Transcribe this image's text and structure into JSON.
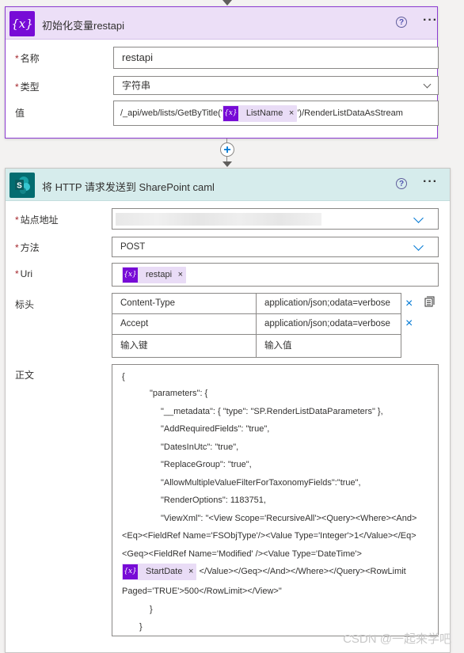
{
  "card1": {
    "title": "初始化变量restapi",
    "fields": {
      "name_label": "名称",
      "name_value": "restapi",
      "type_label": "类型",
      "type_value": "字符串",
      "value_label": "值",
      "value_prefix": "/_api/web/lists/GetByTitle('",
      "value_token": "ListName",
      "value_suffix": "')/RenderListDataAsStream"
    }
  },
  "card2": {
    "title": "将 HTTP 请求发送到 SharePoint caml",
    "site_label": "站点地址",
    "method_label": "方法",
    "method_value": "POST",
    "uri_label": "Uri",
    "uri_token": "restapi",
    "headers_label": "标头",
    "headers": [
      {
        "key": "Content-Type",
        "value": "application/json;odata=verbose"
      },
      {
        "key": "Accept",
        "value": "application/json;odata=verbose"
      }
    ],
    "header_key_placeholder": "输入键",
    "header_value_placeholder": "输入值",
    "body_label": "正文",
    "body_lines": [
      "{",
      "\"parameters\": {",
      "\"__metadata\": { \"type\": \"SP.RenderListDataParameters\" },",
      "\"AddRequiredFields\": \"true\",",
      "\"DatesInUtc\": \"true\",",
      "\"ReplaceGroup\": \"true\",",
      "\"AllowMultipleValueFilterForTaxonomyFields\":\"true\",",
      "\"RenderOptions\": 1183751,",
      "\"ViewXml\": \"<View Scope='RecursiveAll'><Query><Where><And>",
      "<Eq><FieldRef Name='FSObjType'/><Value Type='Integer'>1</Value></Eq>",
      "<Geq><FieldRef Name='Modified' /><Value Type='DateTime'>",
      "</Value></Geq></And></Where></Query><RowLimit",
      "Paged='TRUE'>500</RowLimit></View>\"",
      "}",
      "}"
    ],
    "body_token": "StartDate"
  },
  "icons": {
    "variable": "{x}",
    "help": "?",
    "more": "···",
    "remove": "×"
  },
  "watermark": "CSDN @一起来学吧",
  "colors": {
    "variable_purple": "#770bd6",
    "sharepoint_teal": "#036c70",
    "accent_blue": "#0078d4",
    "required_red": "#a4262c"
  }
}
